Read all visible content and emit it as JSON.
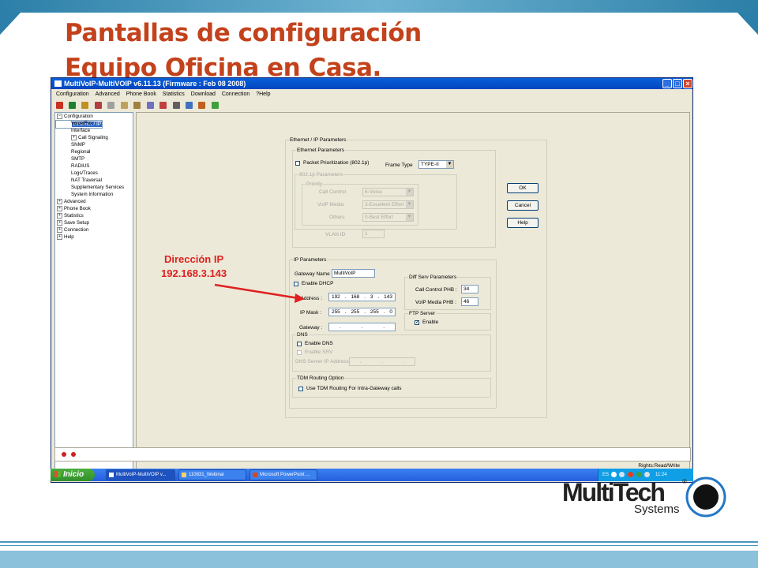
{
  "slide": {
    "title_line1": "Pantallas de configuración",
    "title_line2": "Equipo Oficina en Casa."
  },
  "window": {
    "title": "MultiVoIP-MultiVOIP v6.11.13 (Firmware : Feb 08 2008)",
    "menu": [
      "Configuration",
      "Advanced",
      "Phone Book",
      "Statistics",
      "Download",
      "Connection",
      "?Help"
    ]
  },
  "tree": {
    "items": [
      {
        "label": "Configuration",
        "exp": "−"
      },
      {
        "label": "Ethernet / IP",
        "child": true,
        "selected": true
      },
      {
        "label": "Voice/Fax",
        "child": true
      },
      {
        "label": "Interface",
        "child": true
      },
      {
        "label": "Call Signaling",
        "child": true,
        "exp": "+"
      },
      {
        "label": "SNMP",
        "child": true
      },
      {
        "label": "Regional",
        "child": true
      },
      {
        "label": "SMTP",
        "child": true
      },
      {
        "label": "RADIUS",
        "child": true
      },
      {
        "label": "Logs/Traces",
        "child": true
      },
      {
        "label": "NAT Traversal",
        "child": true
      },
      {
        "label": "Supplementary Services",
        "child": true
      },
      {
        "label": "System Information",
        "child": true
      },
      {
        "label": "Advanced",
        "exp": "+"
      },
      {
        "label": "Phone Book",
        "exp": "+"
      },
      {
        "label": "Statistics",
        "exp": "+"
      },
      {
        "label": "Save Setup",
        "exp": "+"
      },
      {
        "label": "Connection",
        "exp": "+"
      },
      {
        "label": "Help",
        "exp": "+"
      }
    ]
  },
  "form": {
    "outer_legend": "Ethernet / IP Parameters",
    "eth_legend": "Ethernet Parameters",
    "packet_prio": "Packet Prioritization (802.1p)",
    "frame_type_label": "Frame Type",
    "frame_type_value": "TYPE-II",
    "p8021_legend": "802.1p Parameters",
    "priority_legend": "Priority",
    "call_control_label": "Call Control",
    "call_control_value": "6-Voice",
    "voip_media_label": "VoIP Media",
    "voip_media_value": "3-Excellent Effort",
    "others_label": "Others",
    "others_value": "0-Best Effort",
    "vlan_label": "VLAN ID",
    "vlan_value": "1",
    "ip_legend": "IP Parameters",
    "gateway_name_label": "Gateway Name :",
    "gateway_name_value": "MultiVoIP",
    "enable_dhcp": "Enable DHCP",
    "ip_address_label": "IP Address :",
    "ip_address": [
      "192",
      "168",
      "3",
      "143"
    ],
    "ip_mask_label": "IP Mask :",
    "ip_mask": [
      "255",
      "255",
      "255",
      "0"
    ],
    "gateway_label": "Gateway :",
    "gateway": [
      ".",
      ".",
      "."
    ],
    "diffserv_legend": "Diff Serv Parameters",
    "cc_phb_label": "Call Control PHB :",
    "cc_phb_value": "34",
    "vm_phb_label": "VoIP Media PHB :",
    "vm_phb_value": "46",
    "ftp_legend": "FTP Server",
    "ftp_enable": "Enable",
    "dns_legend": "DNS",
    "enable_dns": "Enable DNS",
    "enable_srv": "Enable SRV",
    "dns_server_label": "DNS Server IP Address",
    "tdm_legend": "TDM Routing Option",
    "tdm_option": "Use TDM Routing For Intra-Gateway calls"
  },
  "buttons": {
    "ok": "OK",
    "cancel": "Cancel",
    "help": "Help"
  },
  "status": {
    "rights": "Rights:Read/Write"
  },
  "taskbar": {
    "start": "Inicio",
    "tasks": [
      "MultiVoIP-MultiVOIP v...",
      "110831_Webinar",
      "Microsoft PowerPoint ..."
    ],
    "lang": "ES",
    "clock": "11:24"
  },
  "annotation": {
    "line1": "Dirección IP",
    "line2": "192.168.3.143"
  },
  "logo": {
    "word": "MultiTech",
    "sub": "Systems",
    "reg": "®"
  },
  "colors": {
    "title": "#c3421c",
    "annotation": "#e02020",
    "selection": "#316ac5",
    "titlebar": "#0a5fd8"
  }
}
